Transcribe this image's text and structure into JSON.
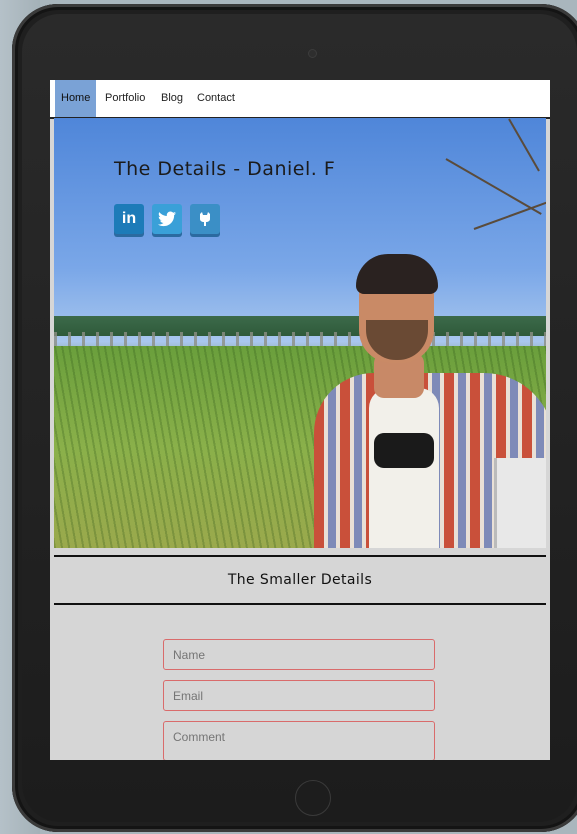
{
  "nav": {
    "items": [
      {
        "label": "Home",
        "active": true
      },
      {
        "label": "Portfolio"
      },
      {
        "label": "Blog"
      },
      {
        "label": "Contact"
      }
    ]
  },
  "hero": {
    "title": "The Details - Daniel. F",
    "social": [
      {
        "name": "linkedin-icon",
        "glyph": "in"
      },
      {
        "name": "twitter-icon",
        "glyph": "🐦"
      },
      {
        "name": "github-icon",
        "glyph": "🐱"
      }
    ]
  },
  "section": {
    "title": "The Smaller Details"
  },
  "form": {
    "name_placeholder": "Name",
    "email_placeholder": "Email",
    "comment_placeholder": "Comment"
  },
  "colors": {
    "nav_active": "#7aa2d6",
    "field_border": "#d96b6b",
    "screen_bg": "#d6d6d6"
  }
}
